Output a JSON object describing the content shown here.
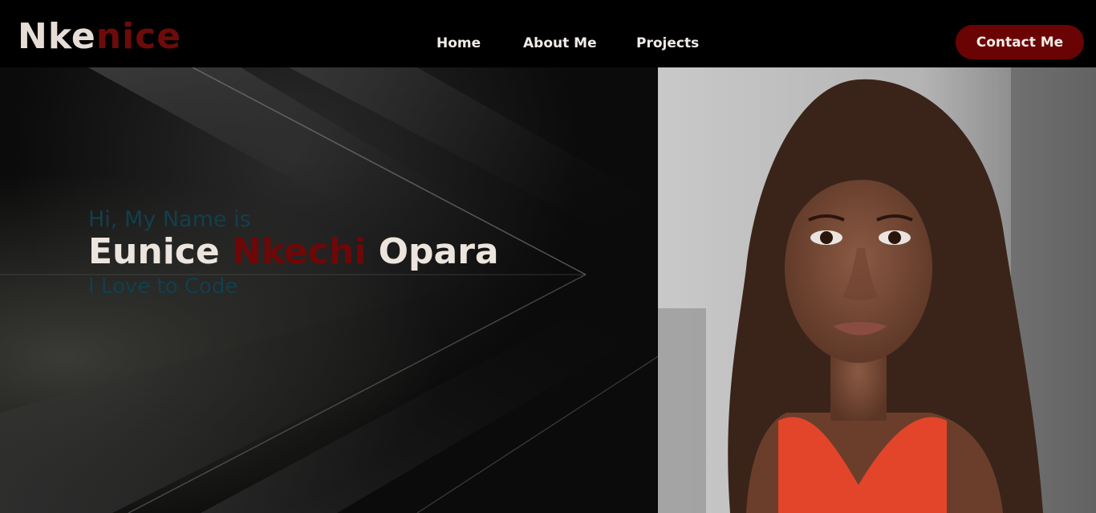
{
  "logo": {
    "part1": "Nke",
    "part2": "nice"
  },
  "nav": {
    "home": "Home",
    "about": "About Me",
    "projects": "Projects"
  },
  "contact_label": "Contact Me",
  "hero": {
    "greeting": "Hi, My Name is",
    "first_name": "Eunice",
    "middle_name": "Nkechi",
    "last_name": "Opara",
    "tagline": "I Love to Code"
  },
  "colors": {
    "accent": "#6a0404",
    "text_light": "#ece5de",
    "teal_text": "#123f4c",
    "background": "#000000"
  }
}
